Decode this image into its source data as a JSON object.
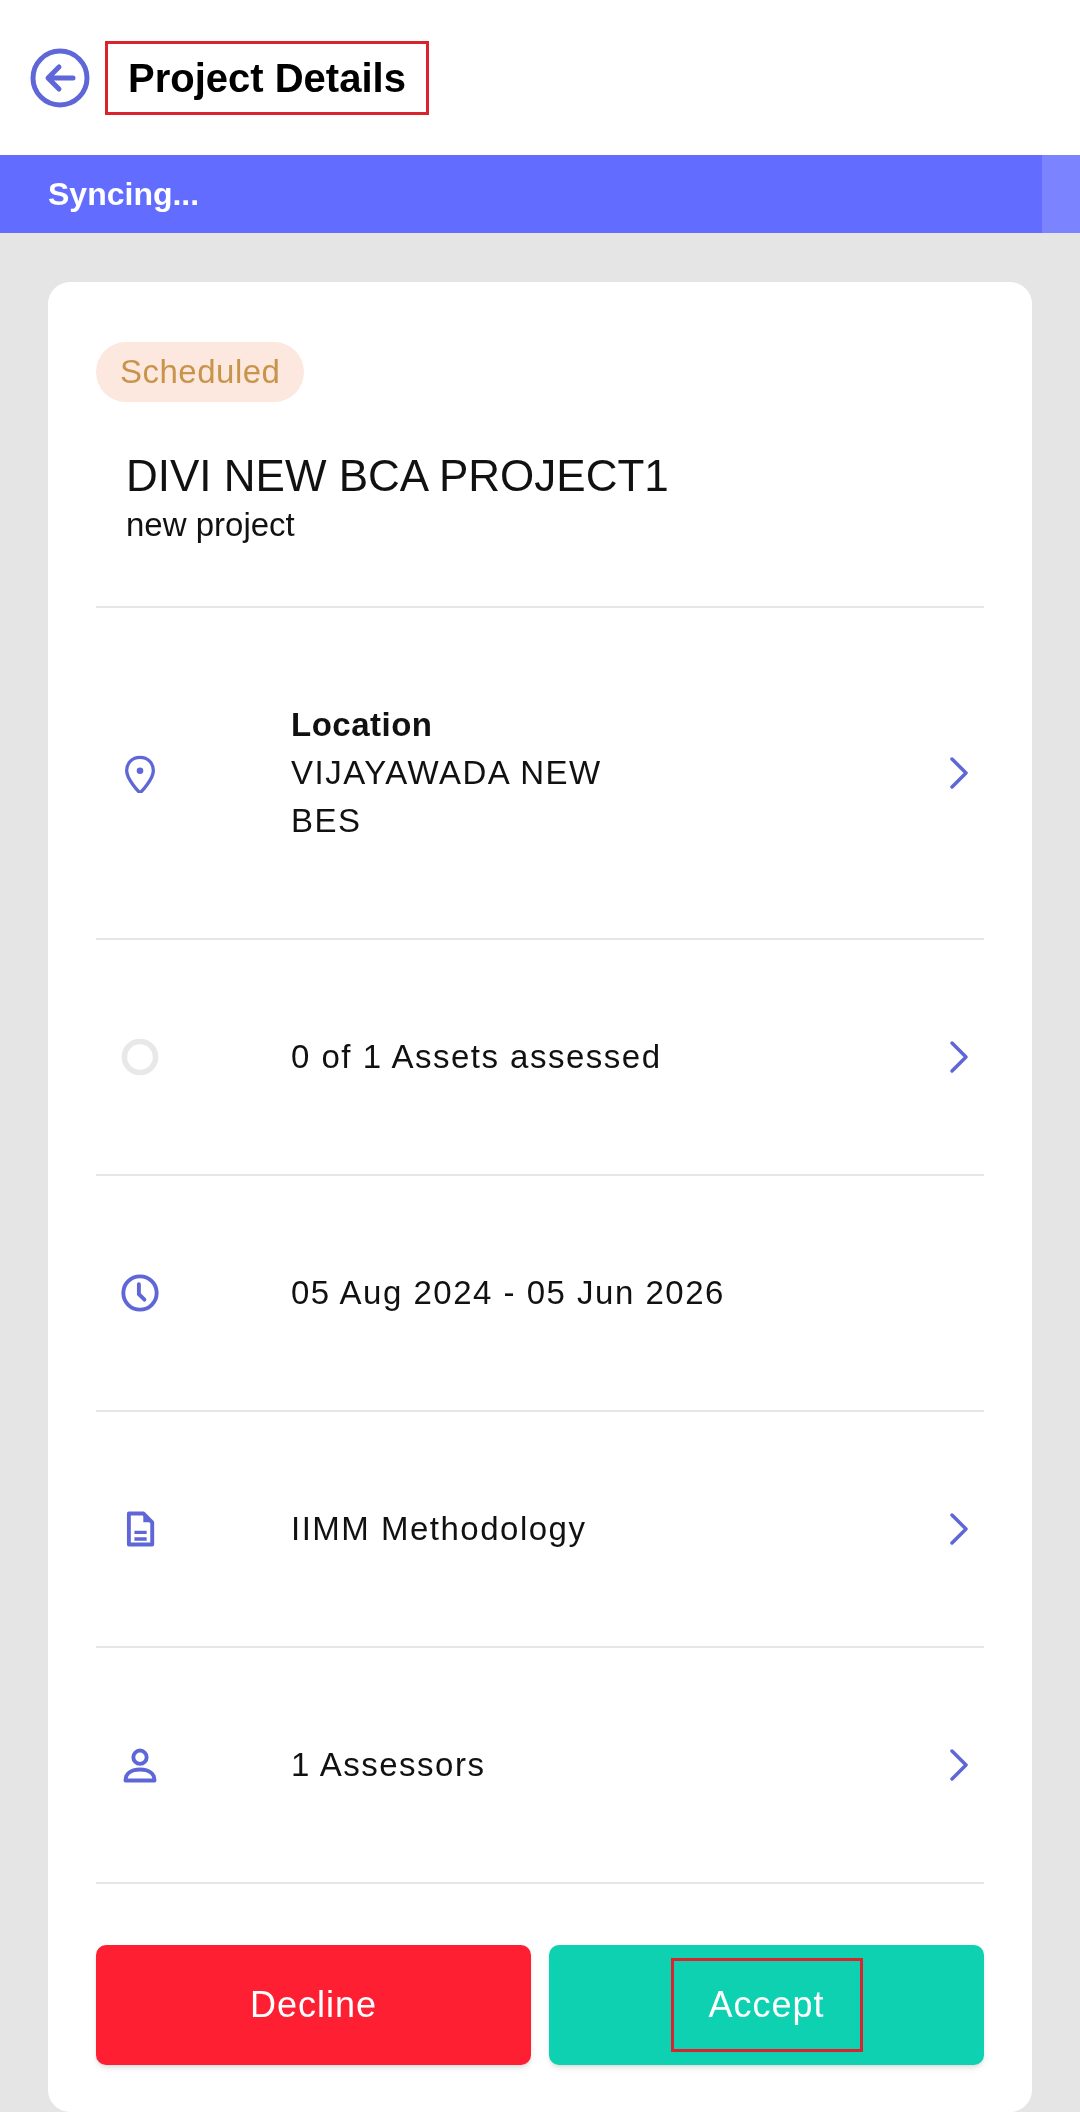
{
  "header": {
    "title": "Project Details",
    "highlighted": true
  },
  "sync_bar": {
    "text": "Syncing..."
  },
  "card": {
    "status": "Scheduled",
    "title": "DIVI NEW BCA PROJECT1",
    "subtitle": "new project",
    "rows": [
      {
        "kind": "location",
        "label": "Location",
        "value": "VIJAYAWADA NEW BES",
        "chevron": true
      },
      {
        "kind": "assets",
        "value": "0 of 1 Assets assessed",
        "chevron": true
      },
      {
        "kind": "dates",
        "value": "05 Aug 2024 - 05 Jun 2026",
        "chevron": false
      },
      {
        "kind": "methodology",
        "value": "IIMM Methodology",
        "chevron": true
      },
      {
        "kind": "assessors",
        "value": "1 Assessors",
        "chevron": true
      }
    ],
    "buttons": [
      {
        "kind": "decline",
        "label": "Decline",
        "highlighted": false
      },
      {
        "kind": "accept",
        "label": "Accept",
        "highlighted": true
      }
    ]
  }
}
